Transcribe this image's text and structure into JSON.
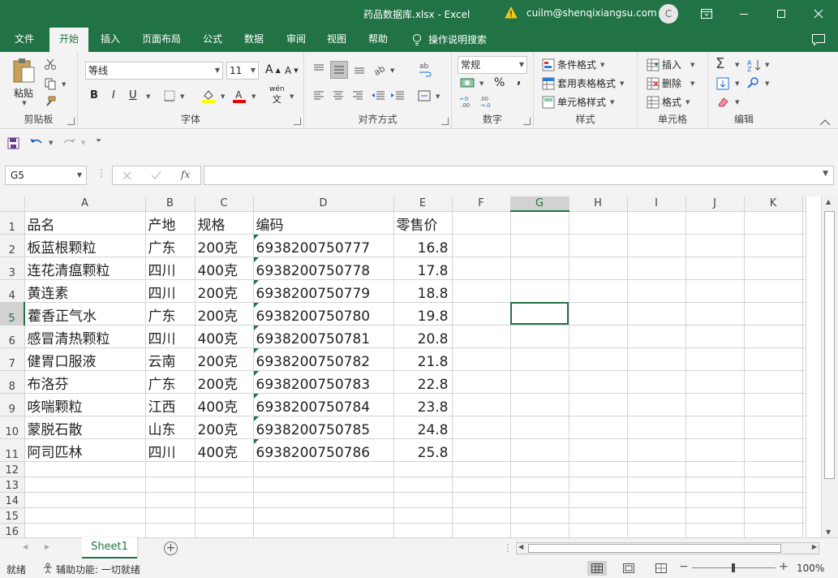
{
  "window": {
    "title": "药品数据库.xlsx  -  Excel",
    "user_email": "cuilm@shenqixiangsu.com",
    "avatar_letter": "C"
  },
  "ribbon_tabs": [
    "文件",
    "开始",
    "插入",
    "页面布局",
    "公式",
    "数据",
    "审阅",
    "视图",
    "帮助"
  ],
  "active_tab": "开始",
  "tell_me": "操作说明搜索",
  "ribbon": {
    "clipboard": {
      "label": "剪贴板",
      "paste": "粘贴"
    },
    "font": {
      "label": "字体",
      "font_name": "等线",
      "font_size": "11",
      "bold": "B",
      "italic": "I",
      "underline": "U",
      "pinyin": "wén"
    },
    "alignment": {
      "label": "对齐方式"
    },
    "number": {
      "label": "数字",
      "format": "常规",
      "percent": "%",
      "comma": ","
    },
    "styles": {
      "label": "样式",
      "conditional": "条件格式",
      "table": "套用表格格式",
      "cell_styles": "单元格样式"
    },
    "cells": {
      "label": "单元格",
      "insert": "插入",
      "delete": "删除",
      "format": "格式"
    },
    "editing": {
      "label": "编辑"
    }
  },
  "formula_bar": {
    "name_box": "G5",
    "fx": "fx",
    "value": ""
  },
  "sheet": {
    "columns": [
      "A",
      "B",
      "C",
      "D",
      "E",
      "F",
      "G",
      "H",
      "I",
      "J",
      "K"
    ],
    "selected_col": "G",
    "selected_row": 5,
    "rows": [
      [
        "品名",
        "产地",
        "规格",
        "编码",
        "零售价"
      ],
      [
        "板蓝根颗粒",
        "广东",
        "200克",
        "6938200750777",
        "16.8"
      ],
      [
        "连花清瘟颗粒",
        "四川",
        "400克",
        "6938200750778",
        "17.8"
      ],
      [
        "黄连素",
        "四川",
        "200克",
        "6938200750779",
        "18.8"
      ],
      [
        "藿香正气水",
        "广东",
        "200克",
        "6938200750780",
        "19.8"
      ],
      [
        "感冒清热颗粒",
        "四川",
        "400克",
        "6938200750781",
        "20.8"
      ],
      [
        "健胃口服液",
        "云南",
        "200克",
        "6938200750782",
        "21.8"
      ],
      [
        "布洛芬",
        "广东",
        "200克",
        "6938200750783",
        "22.8"
      ],
      [
        "咳喘颗粒",
        "江西",
        "400克",
        "6938200750784",
        "23.8"
      ],
      [
        "蒙脱石散",
        "山东",
        "200克",
        "6938200750785",
        "24.8"
      ],
      [
        "阿司匹林",
        "四川",
        "400克",
        "6938200750786",
        "25.8"
      ],
      [
        "",
        "",
        "",
        "",
        ""
      ],
      [
        "",
        "",
        "",
        "",
        ""
      ],
      [
        "",
        "",
        "",
        "",
        ""
      ],
      [
        "",
        "",
        "",
        "",
        ""
      ],
      [
        "",
        "",
        "",
        "",
        ""
      ]
    ]
  },
  "sheet_tabs": [
    "Sheet1"
  ],
  "status": {
    "ready": "就绪",
    "accessibility": "辅助功能: 一切就绪",
    "zoom": "100%"
  },
  "colors": {
    "accent": "#217346",
    "ribbon_bg": "#f3f3f3"
  }
}
